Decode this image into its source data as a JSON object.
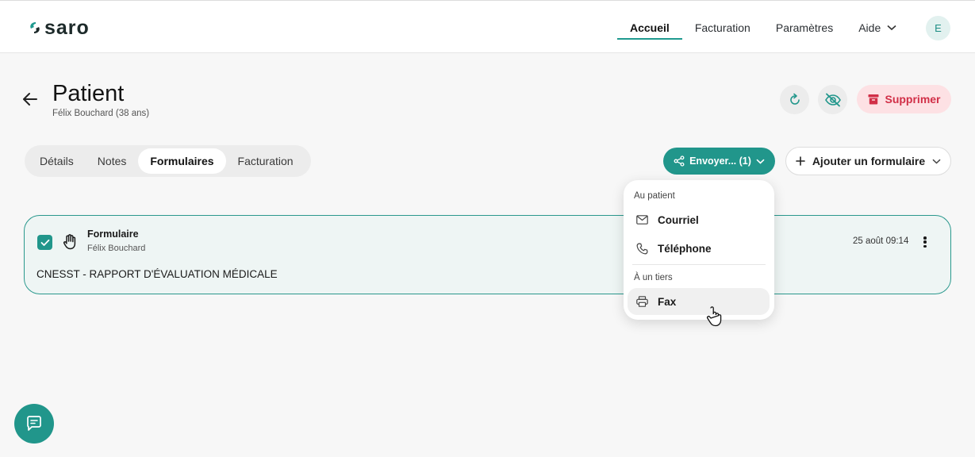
{
  "brand": {
    "logo_text": "saro"
  },
  "nav": {
    "items": [
      {
        "label": "Accueil",
        "active": true
      },
      {
        "label": "Facturation",
        "active": false
      },
      {
        "label": "Paramètres",
        "active": false
      },
      {
        "label": "Aide",
        "active": false,
        "has_dropdown": true
      }
    ],
    "avatar_initial": "E"
  },
  "header": {
    "title": "Patient",
    "subtitle": "Félix Bouchard (38 ans)",
    "actions": {
      "refresh_icon": "refresh-icon",
      "hide_icon": "eye-off-icon",
      "delete_label": "Supprimer"
    }
  },
  "tabs": [
    {
      "label": "Détails",
      "active": false
    },
    {
      "label": "Notes",
      "active": false
    },
    {
      "label": "Formulaires",
      "active": true
    },
    {
      "label": "Facturation",
      "active": false
    }
  ],
  "toolbar": {
    "send_label": "Envoyer... (1)",
    "add_form_label": "Ajouter un formulaire"
  },
  "form_card": {
    "checked": true,
    "title": "Formulaire",
    "patient": "Félix Bouchard",
    "description": "CNESST - RAPPORT D'ÉVALUATION MÉDICALE",
    "date": "25 août 09:14"
  },
  "send_menu": {
    "section_patient": "Au patient",
    "email_label": "Courriel",
    "phone_label": "Téléphone",
    "section_third_party": "À un tiers",
    "fax_label": "Fax"
  },
  "colors": {
    "accent": "#21968b",
    "danger": "#d12f47",
    "danger_bg": "#fde1e4"
  }
}
